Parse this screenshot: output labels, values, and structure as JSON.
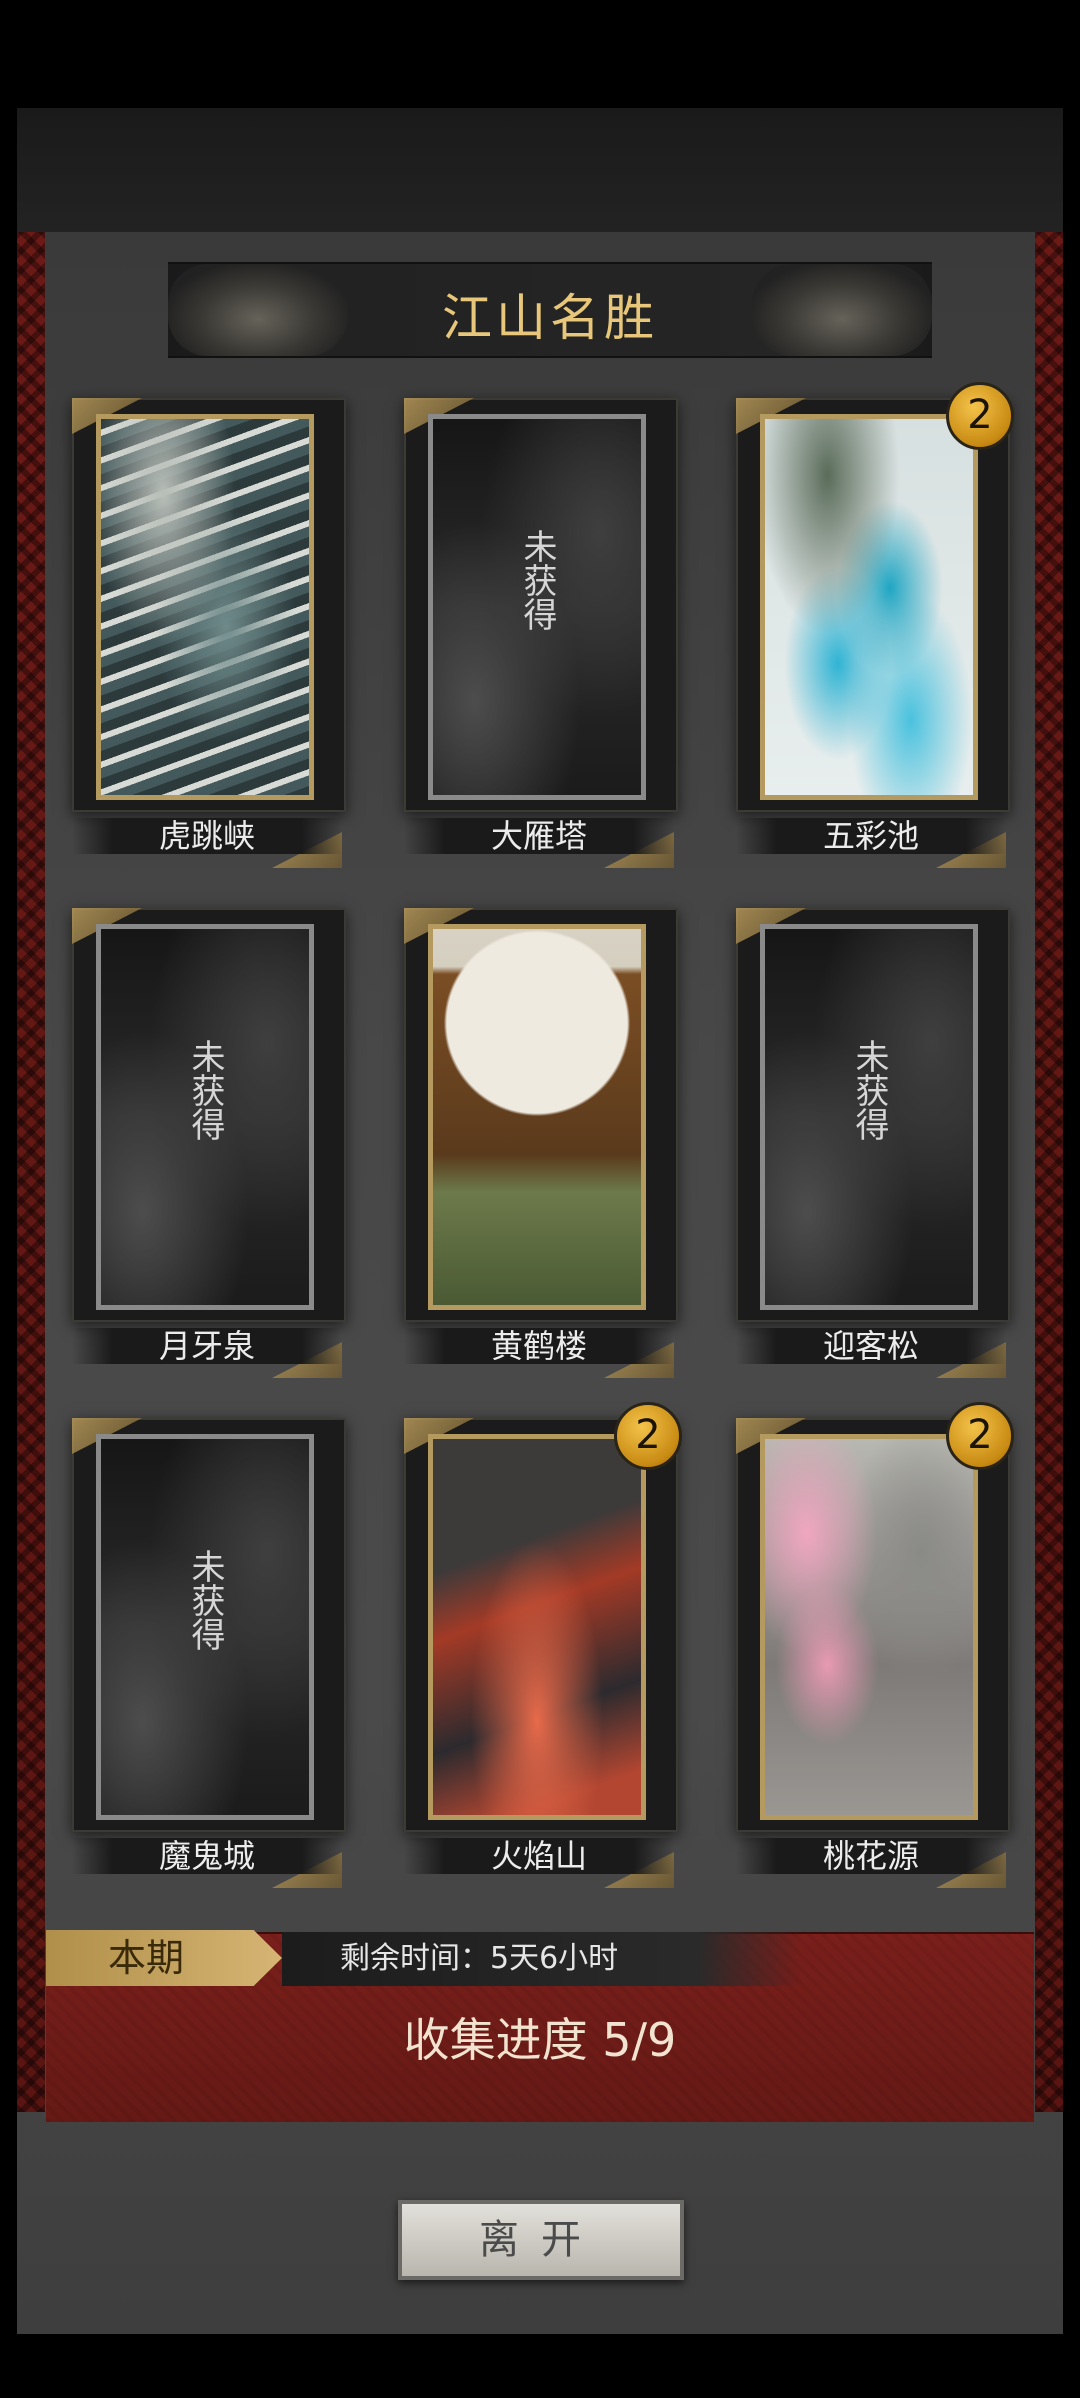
{
  "title": "江山名胜",
  "cards": [
    {
      "name": "虎跳峡",
      "locked": false,
      "badge": null
    },
    {
      "name": "大雁塔",
      "locked": true,
      "badge": null
    },
    {
      "name": "五彩池",
      "locked": false,
      "badge": "2"
    },
    {
      "name": "月牙泉",
      "locked": true,
      "badge": null
    },
    {
      "name": "黄鹤楼",
      "locked": false,
      "badge": null
    },
    {
      "name": "迎客松",
      "locked": true,
      "badge": null
    },
    {
      "name": "魔鬼城",
      "locked": true,
      "badge": null
    },
    {
      "name": "火焰山",
      "locked": false,
      "badge": "2"
    },
    {
      "name": "桃花源",
      "locked": false,
      "badge": "2"
    }
  ],
  "locked_text": "未获得",
  "period": {
    "tag": "本期",
    "remaining": "剩余时间：5天6小时",
    "progress": "收集进度  5/9"
  },
  "leave_button": "离开",
  "colors": {
    "gold": "#e8c77a",
    "badge": "#f4c34a",
    "panel_red": "#7a1f1b"
  }
}
